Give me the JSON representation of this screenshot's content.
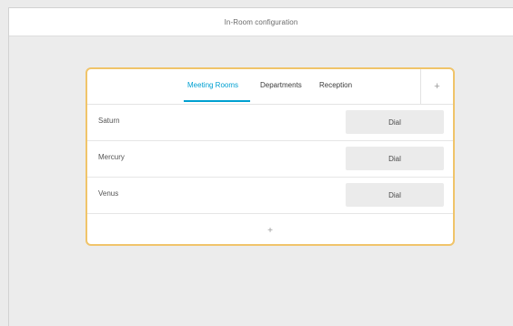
{
  "header": {
    "title": "In-Room configuration"
  },
  "tabs": [
    {
      "label": "Meeting Rooms",
      "active": true
    },
    {
      "label": "Departments",
      "active": false
    },
    {
      "label": "Reception",
      "active": false
    }
  ],
  "add_tab_label": "+",
  "rows": [
    {
      "label": "Saturn",
      "action": "Dial"
    },
    {
      "label": "Mercury",
      "action": "Dial"
    },
    {
      "label": "Venus",
      "action": "Dial"
    }
  ],
  "add_row_label": "+",
  "colors": {
    "accent": "#00a0d1",
    "panel_border": "#f0c46a",
    "background": "#ebebeb"
  }
}
